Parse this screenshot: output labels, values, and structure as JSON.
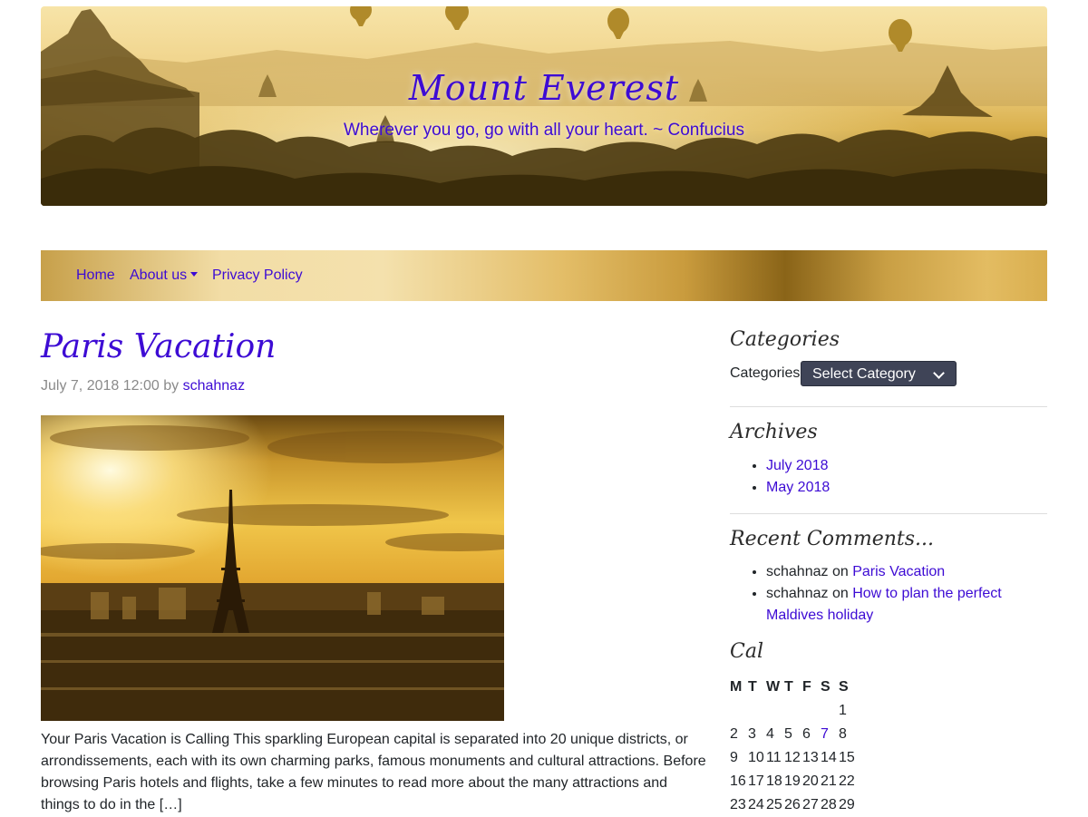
{
  "header": {
    "site_title": "Mount Everest",
    "tagline": "Wherever you go, go with all your heart. ~ Confucius"
  },
  "nav": {
    "items": [
      {
        "label": "Home"
      },
      {
        "label": "About us",
        "has_dropdown": true
      },
      {
        "label": "Privacy Policy"
      }
    ]
  },
  "post": {
    "title": "Paris Vacation",
    "date": "July 7, 2018 12:00",
    "by_label": "by",
    "author": "schahnaz",
    "excerpt": "Your Paris Vacation is Calling This sparkling European capital is separated into 20 unique districts, or arrondissements, each with its own charming parks, famous monuments and cultural attractions. Before browsing Paris hotels and flights, take a few minutes to read more about the many attractions and things to do in the […]"
  },
  "sidebar": {
    "categories": {
      "title": "Categories",
      "label": "Categories",
      "select_value": "Select Category"
    },
    "archives": {
      "title": "Archives",
      "items": [
        "July 2018",
        "May 2018"
      ]
    },
    "recent_comments": {
      "title": "Recent Comments...",
      "on_label": "on",
      "items": [
        {
          "author": "schahnaz",
          "post": "Paris Vacation"
        },
        {
          "author": "schahnaz",
          "post": "How to plan the perfect Maldives holiday"
        }
      ]
    },
    "calendar": {
      "title": "Cal",
      "headers": [
        "M",
        "T",
        "W",
        "T",
        "F",
        "S",
        "S"
      ],
      "rows": [
        [
          "",
          "",
          "",
          "",
          "",
          "",
          "1"
        ],
        [
          "2",
          "3",
          "4",
          "5",
          "6",
          "7",
          "8"
        ],
        [
          "9",
          "10",
          "11",
          "12",
          "13",
          "14",
          "15"
        ],
        [
          "16",
          "17",
          "18",
          "19",
          "20",
          "21",
          "22"
        ],
        [
          "23",
          "24",
          "25",
          "26",
          "27",
          "28",
          "29"
        ]
      ],
      "linked_day": "7"
    }
  },
  "colors": {
    "link": "#3d0bd4",
    "banner_gold": "#e3bd67",
    "select_bg": "#3f4457"
  }
}
